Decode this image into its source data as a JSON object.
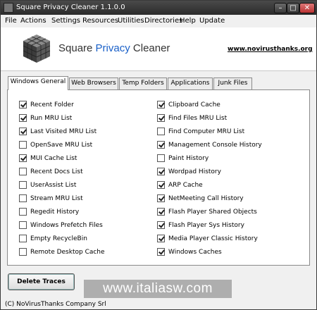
{
  "window": {
    "title": "Square Privacy Cleaner 1.1.0.0",
    "min": "–",
    "max": "□",
    "close": "✕"
  },
  "menu": [
    "File",
    "Actions",
    "Settings",
    "Resources",
    "Utilities",
    "Directories",
    "Help",
    "Update"
  ],
  "header": {
    "name_part1": "Square ",
    "name_accent": "Privacy",
    "name_part2": " Cleaner",
    "link": "www.novirusthanks.org",
    "accent_color": "#1a60c8"
  },
  "tabs": [
    "Windows General",
    "Web Browsers",
    "Temp Folders",
    "Applications",
    "Junk Files"
  ],
  "active_tab": 0,
  "left_options": [
    {
      "label": "Recent Folder",
      "checked": true
    },
    {
      "label": "Run MRU List",
      "checked": true
    },
    {
      "label": "Last Visited MRU List",
      "checked": true
    },
    {
      "label": "OpenSave MRU List",
      "checked": false
    },
    {
      "label": "MUI Cache List",
      "checked": true
    },
    {
      "label": "Recent Docs List",
      "checked": false
    },
    {
      "label": "UserAssist List",
      "checked": false
    },
    {
      "label": "Stream MRU List",
      "checked": false
    },
    {
      "label": "Regedit History",
      "checked": false
    },
    {
      "label": "Windows Prefetch Files",
      "checked": false
    },
    {
      "label": "Empty RecycleBin",
      "checked": false
    },
    {
      "label": "Remote Desktop Cache",
      "checked": false
    }
  ],
  "right_options": [
    {
      "label": "Clipboard Cache",
      "checked": true
    },
    {
      "label": "Find Files MRU List",
      "checked": true
    },
    {
      "label": "Find Computer MRU List",
      "checked": false
    },
    {
      "label": "Management Console History",
      "checked": true
    },
    {
      "label": "Paint History",
      "checked": false
    },
    {
      "label": "Wordpad History",
      "checked": true
    },
    {
      "label": "ARP Cache",
      "checked": true
    },
    {
      "label": "NetMeeting Call History",
      "checked": true
    },
    {
      "label": "Flash Player Shared Objects",
      "checked": true
    },
    {
      "label": "Flash Player Sys History",
      "checked": true
    },
    {
      "label": "Media Player Classic History",
      "checked": true
    },
    {
      "label": "Windows Caches",
      "checked": true
    }
  ],
  "delete_button": "Delete Traces",
  "watermark": "www.italiasw.com",
  "status": "(C) NoVirusThanks Company Srl"
}
